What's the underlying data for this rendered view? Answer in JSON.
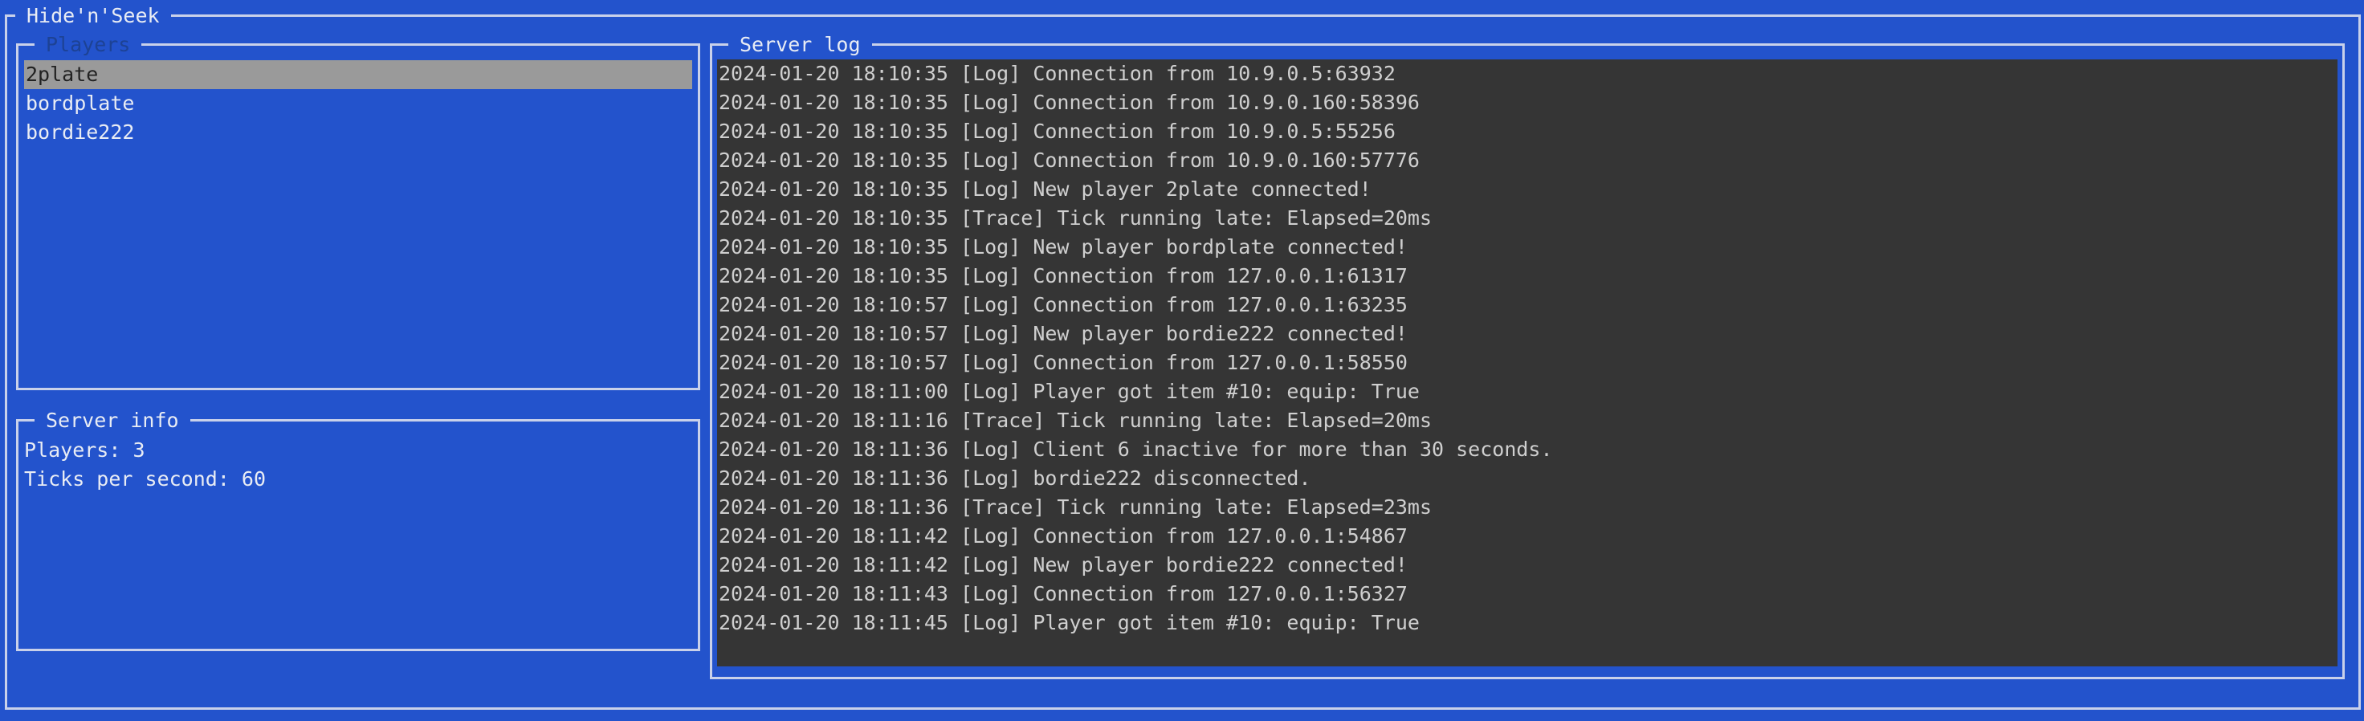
{
  "app": {
    "title": "Hide'n'Seek"
  },
  "players_panel": {
    "title": "Players",
    "items": [
      "2plate",
      "bordplate",
      "bordie222"
    ],
    "selected_index": 0
  },
  "server_info": {
    "title": "Server info",
    "players_line": "Players: 3",
    "ticks_line": "Ticks per second: 60"
  },
  "server_log": {
    "title": "Server log",
    "lines": [
      "2024-01-20 18:10:35 [Log] Connection from 10.9.0.5:63932",
      "2024-01-20 18:10:35 [Log] Connection from 10.9.0.160:58396",
      "2024-01-20 18:10:35 [Log] Connection from 10.9.0.5:55256",
      "2024-01-20 18:10:35 [Log] Connection from 10.9.0.160:57776",
      "2024-01-20 18:10:35 [Log] New player 2plate connected!",
      "2024-01-20 18:10:35 [Trace] Tick running late: Elapsed=20ms",
      "2024-01-20 18:10:35 [Log] New player bordplate connected!",
      "2024-01-20 18:10:35 [Log] Connection from 127.0.0.1:61317",
      "2024-01-20 18:10:57 [Log] Connection from 127.0.0.1:63235",
      "2024-01-20 18:10:57 [Log] New player bordie222 connected!",
      "2024-01-20 18:10:57 [Log] Connection from 127.0.0.1:58550",
      "2024-01-20 18:11:00 [Log] Player got item #10: equip: True",
      "2024-01-20 18:11:16 [Trace] Tick running late: Elapsed=20ms",
      "2024-01-20 18:11:36 [Log] Client 6 inactive for more than 30 seconds.",
      "2024-01-20 18:11:36 [Log] bordie222 disconnected.",
      "2024-01-20 18:11:36 [Trace] Tick running late: Elapsed=23ms",
      "2024-01-20 18:11:42 [Log] Connection from 127.0.0.1:54867",
      "2024-01-20 18:11:42 [Log] New player bordie222 connected!",
      "2024-01-20 18:11:43 [Log] Connection from 127.0.0.1:56327",
      "2024-01-20 18:11:45 [Log] Player got item #10: equip: True"
    ]
  }
}
